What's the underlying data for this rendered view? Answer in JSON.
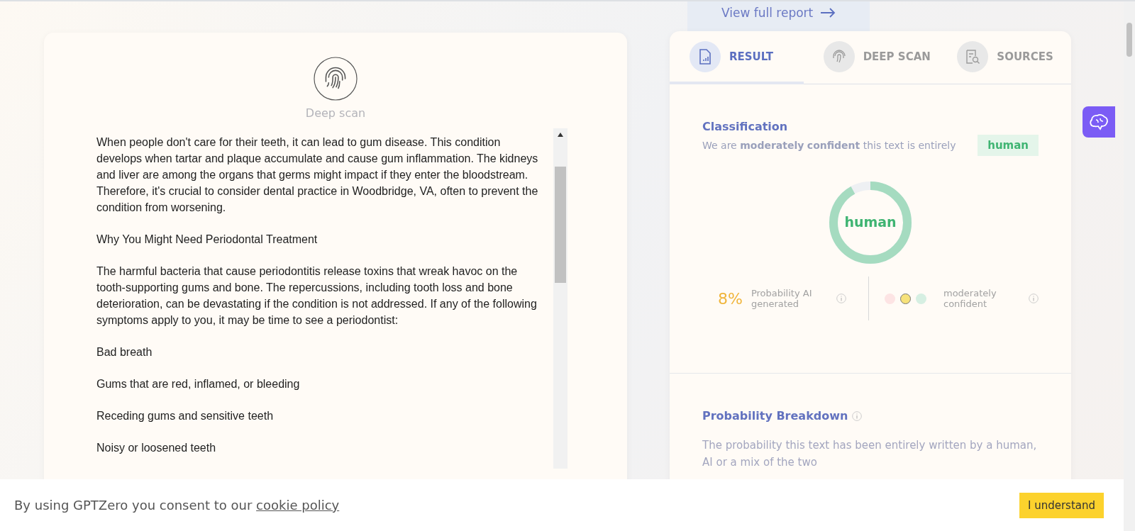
{
  "report_link": {
    "label": "View full report"
  },
  "scan_panel": {
    "title": "Deep scan",
    "paragraphs": [
      "When people don't care for their teeth, it can lead to gum disease. This condition develops when tartar and plaque accumulate and cause gum inflammation. The kidneys and liver are among the organs that germs might impact if they enter the bloodstream. Therefore, it's crucial to consider dental practice in Woodbridge, VA, often to prevent the condition from worsening.",
      "Why You Might Need Periodontal Treatment",
      "The harmful bacteria that cause periodontitis release toxins that wreak havoc on the tooth-supporting gums and bone. The repercussions, including tooth loss and bone deterioration, can be devastating if the condition is not addressed. If any of the following symptoms apply to you, it may be time to see a periodontist:",
      "Bad breath",
      "Gums that are red, inflamed, or bleeding",
      "Receding gums and sensitive teeth",
      "Noisy or loosened teeth"
    ]
  },
  "tabs": [
    {
      "label": "RESULT",
      "kind": "document",
      "selected": true
    },
    {
      "label": "DEEP SCAN",
      "kind": "fingerprint",
      "selected": false
    },
    {
      "label": "SOURCES",
      "kind": "sources",
      "selected": false
    }
  ],
  "classification": {
    "title": "Classification",
    "sentence": "We are **moderately** **confident** this text is entirely",
    "badge": "human",
    "donut_label": "human",
    "level": 0.92,
    "probability": {
      "value": "8%",
      "label": "Probability AI generated"
    },
    "confidence": {
      "label": "moderately confident",
      "dots": [
        {
          "color": "#fde4e4",
          "selected": false
        },
        {
          "color": "#f7e27a",
          "selected": true
        },
        {
          "color": "#d6efe2",
          "selected": false
        }
      ]
    }
  },
  "breakdown": {
    "title": "Probability Breakdown",
    "text": "The probability this text has been entirely written by a human, AI or a mix of the two"
  },
  "cookie_bar": {
    "text": "By using GPTZero you consent to our",
    "link": "cookie policy",
    "button": "I understand"
  }
}
